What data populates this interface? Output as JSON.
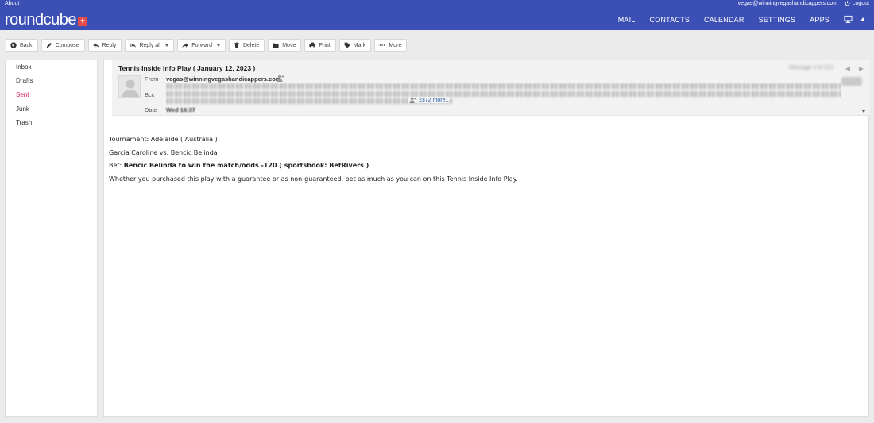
{
  "topline": {
    "about": "About",
    "user_email": "vegas@winningvegashandicappers.com",
    "logout": "Logout"
  },
  "header": {
    "logo_text": "roundcube",
    "logo_plus": "+",
    "nav": [
      "MAIL",
      "CONTACTS",
      "CALENDAR",
      "SETTINGS",
      "APPS"
    ],
    "icons": [
      "monitor-icon",
      "collapse-caret-icon"
    ]
  },
  "toolbar": {
    "back": "Back",
    "compose": "Compose",
    "reply": "Reply",
    "reply_all": "Reply all",
    "forward": "Forward",
    "delete": "Delete",
    "move": "Move",
    "print": "Print",
    "mark": "Mark",
    "more": "More"
  },
  "folders": [
    {
      "label": "Inbox",
      "active": false
    },
    {
      "label": "Drafts",
      "active": false
    },
    {
      "label": "Sent",
      "active": true
    },
    {
      "label": "Junk",
      "active": false
    },
    {
      "label": "Trash",
      "active": false
    }
  ],
  "message": {
    "subject": "Tennis Inside Info Play ( January 12, 2023 )",
    "counter": "Message 4 of 912",
    "from_label": "From",
    "from": "vegas@winningvegashandicappers.com",
    "bcc_label": "Bcc",
    "bcc_more": "2372 more...",
    "date_label": "Date",
    "date": "Wed 16:37",
    "body": {
      "tournament": "Tournament: Adelaide ( Australia )",
      "match": "Garcia Caroline vs. Bencic Belinda",
      "bet_label": "Bet: ",
      "bet": "Bencic Belinda to win the match/odds -120 ( sportsbook: BetRivers )",
      "note": "Whether you purchased this play with a guarantee or as non-guaranteed, bet as much as you can on this Tennis Inside Info Play."
    }
  },
  "colors": {
    "header_bg": "#3c4fb5",
    "active_folder": "#d31f51",
    "link": "#2a59a8",
    "logo_plus": "#e54c4c"
  }
}
